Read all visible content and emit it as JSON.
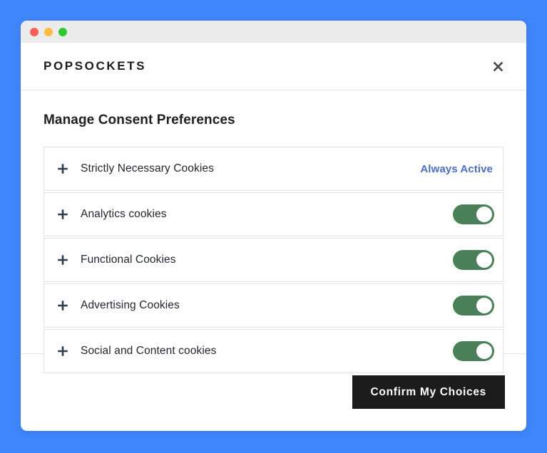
{
  "theme": {
    "page_background": "#3f86fb",
    "titlebar_background": "#ececed",
    "accent_blue": "#4a6ed0",
    "toggle_on_color": "#4a8058",
    "confirm_button_background": "#1b1b1b",
    "text_color": "#22272e"
  },
  "titlebar": {
    "dots": [
      {
        "name": "close",
        "color": "#fc5f57"
      },
      {
        "name": "minimize",
        "color": "#fdbc40"
      },
      {
        "name": "maximize",
        "color": "#2dc92e"
      }
    ]
  },
  "header": {
    "brand": "POPSOCKETS",
    "close_icon": "close-icon"
  },
  "body": {
    "section_title": "Manage Consent Preferences",
    "categories": [
      {
        "id": "strictly-necessary",
        "label": "Strictly Necessary Cookies",
        "expand_icon": "plus-icon",
        "control": "status",
        "status_text": "Always Active"
      },
      {
        "id": "analytics",
        "label": "Analytics cookies",
        "expand_icon": "plus-icon",
        "control": "toggle",
        "toggle_on": true
      },
      {
        "id": "functional",
        "label": "Functional Cookies",
        "expand_icon": "plus-icon",
        "control": "toggle",
        "toggle_on": true
      },
      {
        "id": "advertising",
        "label": "Advertising Cookies",
        "expand_icon": "plus-icon",
        "control": "toggle",
        "toggle_on": true
      },
      {
        "id": "social-content",
        "label": "Social and Content cookies",
        "expand_icon": "plus-icon",
        "control": "toggle",
        "toggle_on": true
      }
    ]
  },
  "footer": {
    "confirm_label": "Confirm My Choices"
  }
}
